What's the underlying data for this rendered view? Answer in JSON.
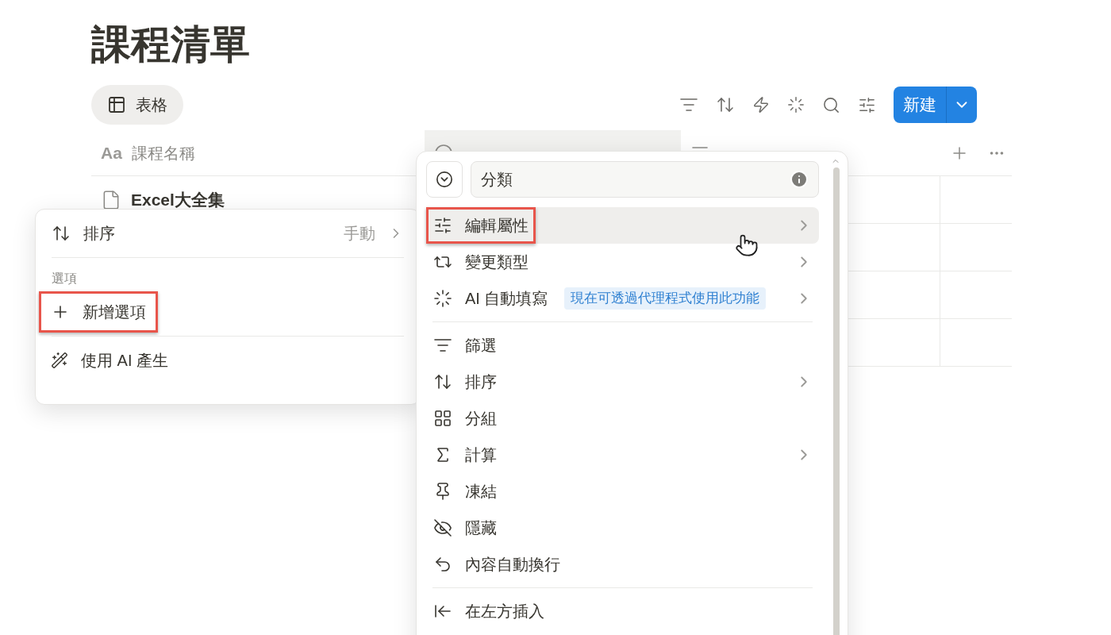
{
  "page_title": "課程清單",
  "view_tab": {
    "label": "表格",
    "selected": true
  },
  "new_button": {
    "label": "新建"
  },
  "table": {
    "columns": [
      {
        "label": "課程名稱",
        "type_glyph": "Aa",
        "selected": false
      },
      {
        "selected": true
      },
      {
        "selected": false
      }
    ],
    "rows": [
      {
        "title": "Excel大全集"
      }
    ]
  },
  "property_menu": {
    "name_field": {
      "value": "分類"
    },
    "sections": [
      [
        {
          "label": "編輯屬性",
          "submenu": true,
          "hovered": true,
          "highlighted": true
        },
        {
          "label": "變更類型",
          "submenu": true,
          "hovered": false,
          "highlighted": false
        },
        {
          "label": "AI 自動填寫",
          "badge": "現在可透過代理程式使用此功能",
          "submenu": true,
          "hovered": false,
          "highlighted": false
        }
      ],
      [
        {
          "label": "篩選",
          "submenu": false,
          "hovered": false,
          "highlighted": false
        },
        {
          "label": "排序",
          "submenu": true,
          "hovered": false,
          "highlighted": false
        },
        {
          "label": "分組",
          "submenu": false,
          "hovered": false,
          "highlighted": false
        },
        {
          "label": "計算",
          "submenu": true,
          "hovered": false,
          "highlighted": false
        },
        {
          "label": "凍結",
          "submenu": false,
          "hovered": false,
          "highlighted": false
        },
        {
          "label": "隱藏",
          "submenu": false,
          "hovered": false,
          "highlighted": false
        },
        {
          "label": "內容自動換行",
          "submenu": false,
          "hovered": false,
          "highlighted": false
        }
      ],
      [
        {
          "label": "在左方插入",
          "submenu": false,
          "hovered": false,
          "highlighted": false
        }
      ]
    ]
  },
  "option_menu": {
    "sort": {
      "label": "排序",
      "value": "手動"
    },
    "section_label": "選項",
    "items": [
      {
        "label": "新增選項",
        "highlighted": true
      },
      {
        "label": "使用 AI 產生",
        "highlighted": false
      }
    ]
  }
}
